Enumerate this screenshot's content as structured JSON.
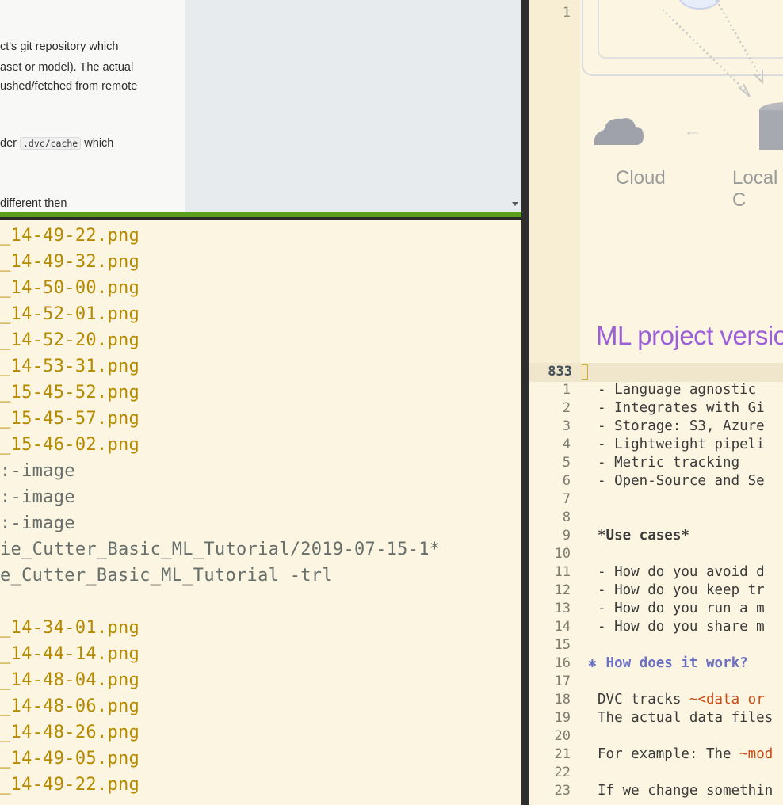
{
  "browser": {
    "doc_lines": [
      "ct's git repository which",
      "aset or model). The actual",
      "ushed/fetched from remote",
      "der ",
      " which",
      "different then"
    ],
    "inline_code": ".dvc/cache"
  },
  "file_list": [
    {
      "text": "_14-49-22.png",
      "kind": "png"
    },
    {
      "text": "_14-49-32.png",
      "kind": "png"
    },
    {
      "text": "_14-50-00.png",
      "kind": "png"
    },
    {
      "text": "_14-52-01.png",
      "kind": "png"
    },
    {
      "text": "_14-52-20.png",
      "kind": "png"
    },
    {
      "text": "_14-53-31.png",
      "kind": "png"
    },
    {
      "text": "_15-45-52.png",
      "kind": "png"
    },
    {
      "text": "_15-45-57.png",
      "kind": "png"
    },
    {
      "text": "_15-46-02.png",
      "kind": "png"
    },
    {
      "text": ":-image",
      "kind": "other"
    },
    {
      "text": ":-image",
      "kind": "other"
    },
    {
      "text": ":-image",
      "kind": "other"
    },
    {
      "text": "ie_Cutter_Basic_ML_Tutorial/2019-07-15-1*",
      "kind": "other"
    },
    {
      "text": "e_Cutter_Basic_ML_Tutorial -trl",
      "kind": "other"
    },
    {
      "text": "",
      "kind": "other"
    },
    {
      "text": "_14-34-01.png",
      "kind": "png"
    },
    {
      "text": "_14-44-14.png",
      "kind": "png"
    },
    {
      "text": "_14-48-04.png",
      "kind": "png"
    },
    {
      "text": "_14-48-06.png",
      "kind": "png"
    },
    {
      "text": "_14-48-26.png",
      "kind": "png"
    },
    {
      "text": "_14-49-05.png",
      "kind": "png"
    },
    {
      "text": "_14-49-22.png",
      "kind": "png"
    }
  ],
  "editor": {
    "top_line_number": "1",
    "diagram": {
      "cloud_label": "Cloud",
      "local_label": "Local C",
      "arrow": "←"
    },
    "heading": "ML project versio",
    "current_line_number": "833",
    "lines": [
      {
        "n": "1",
        "text": "- Language agnostic"
      },
      {
        "n": "2",
        "text": "- Integrates with Gi"
      },
      {
        "n": "3",
        "text": "- Storage: S3, Azure"
      },
      {
        "n": "4",
        "text": "- Lightweight pipeli"
      },
      {
        "n": "5",
        "text": "- Metric tracking"
      },
      {
        "n": "6",
        "text": "- Open-Source and Se"
      },
      {
        "n": "7",
        "text": ""
      },
      {
        "n": "8",
        "text": ""
      },
      {
        "n": "9",
        "text": "*Use cases*",
        "style": "bold"
      },
      {
        "n": "10",
        "text": ""
      },
      {
        "n": "11",
        "text": "- How do you avoid d"
      },
      {
        "n": "12",
        "text": "- How do you keep tr"
      },
      {
        "n": "13",
        "text": "- How do you run a m"
      },
      {
        "n": "14",
        "text": "- How do you share m"
      },
      {
        "n": "15",
        "text": ""
      },
      {
        "n": "16",
        "text": "How does it work?",
        "style": "heading",
        "bullet": "✱"
      },
      {
        "n": "17",
        "text": ""
      },
      {
        "n": "18",
        "text": "DVC tracks ",
        "hl": "~<data or"
      },
      {
        "n": "19",
        "text": "The actual data files"
      },
      {
        "n": "20",
        "text": ""
      },
      {
        "n": "21",
        "text": "For example: The ",
        "hl": "~mod"
      },
      {
        "n": "22",
        "text": ""
      },
      {
        "n": "23",
        "text": "If we change somethin"
      }
    ]
  },
  "colors": {
    "frame_active": "#5a9e1b",
    "png_file": "#b58900",
    "heading": "#9b5fd6",
    "org_heading": "#6c71c4",
    "highlight": "#cb4b16",
    "background": "#fcf5e1"
  }
}
